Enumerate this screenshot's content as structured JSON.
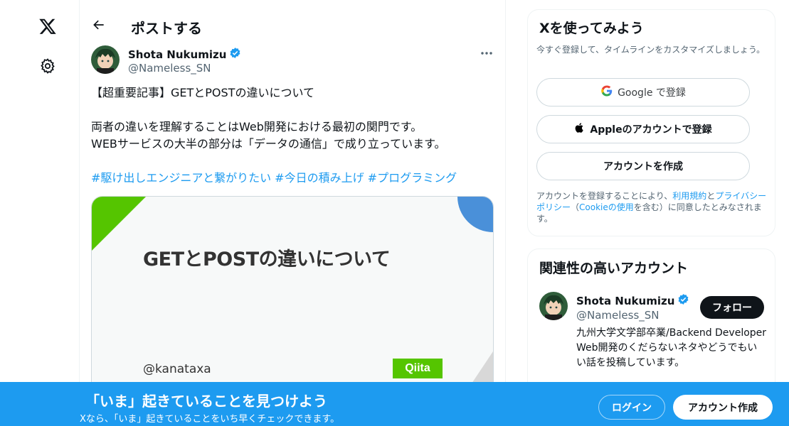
{
  "nav": {
    "logo_icon": "x-logo-icon",
    "settings_icon": "gear-icon"
  },
  "header": {
    "title": "ポストする"
  },
  "post": {
    "author_name": "Shota Nukumizu",
    "author_handle": "@Nameless_SN",
    "text_line1": "【超重要記事】GETとPOSTの違いについて",
    "text_line2": "両者の違いを理解することはWeb開発における最初の関門です。",
    "text_line3": "WEBサービスの大半の部分は「データの通信」で成り立っています。",
    "hashtags": "#駆け出しエンジニアと繋がりたい #今日の積み上げ #プログラミング",
    "card": {
      "title": "GETとPOSTの違いについて",
      "author": "@kanataxa",
      "logo": "Qiita"
    }
  },
  "signup": {
    "title": "Xを使ってみよう",
    "subtitle": "今すぐ登録して、タイムラインをカスタマイズしましょう。",
    "google_label": "Google で登録",
    "apple_label": "Appleのアカウントで登録",
    "create_label": "アカウントを作成",
    "terms_prefix": "アカウントを登録することにより、",
    "terms_link": "利用規約",
    "terms_and": "と",
    "privacy_link": "プライバシーポリシー",
    "terms_paren_open": "（",
    "cookie_link": "Cookieの使用",
    "terms_suffix": "を含む）に同意したとみなされます。"
  },
  "related": {
    "title": "関連性の高いアカウント",
    "name": "Shota Nukumizu",
    "handle": "@Nameless_SN",
    "follow_label": "フォロー",
    "bio": "九州大学文学部卒業/Backend Developer Web開発のくだらないネタやどうでもいい話を投稿しています。"
  },
  "banner": {
    "title": "「いま」起きていることを見つけよう",
    "subtitle": "Xなら、「いま」起きていることをいち早くチェックできます。",
    "login_label": "ログイン",
    "signup_label": "アカウント作成"
  },
  "colors": {
    "accent": "#1d9bf0",
    "verified": "#1d9bf0",
    "qiita_green": "#55c500"
  }
}
